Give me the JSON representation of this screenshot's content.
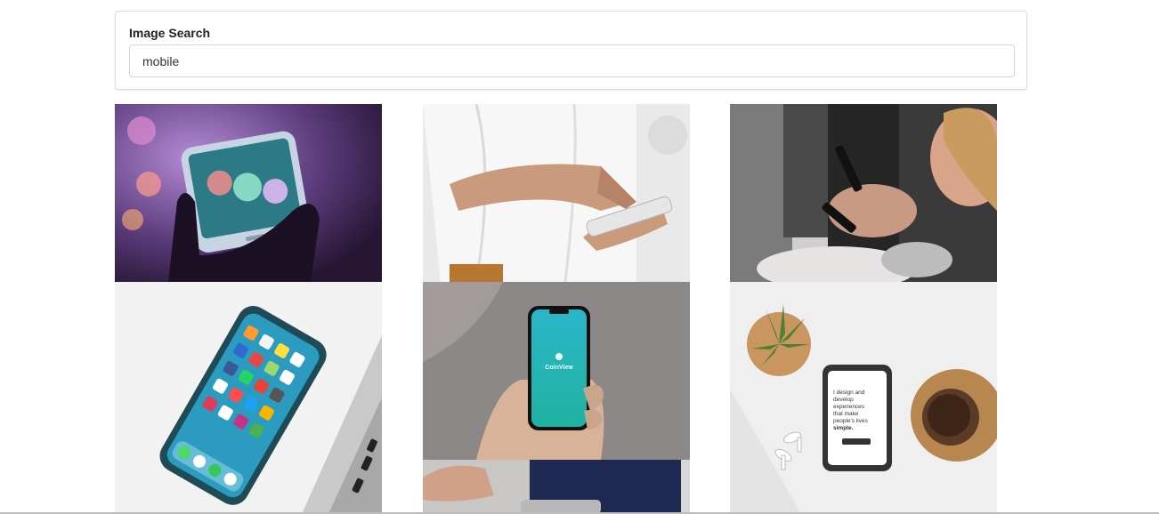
{
  "search": {
    "label": "Image Search",
    "value": "mobile"
  },
  "results": [
    {
      "icon": "phone-bokeh-image"
    },
    {
      "icon": "man-using-phone-image"
    },
    {
      "icon": "people-phones-image"
    },
    {
      "icon": "iphone-app-grid-image"
    },
    {
      "icon": "hand-holding-phone-image",
      "screen_text": "CoinView"
    },
    {
      "icon": "phone-on-desk-image",
      "screen_text": [
        "I design and",
        "develop",
        "experiences",
        "that make",
        "people's lives",
        "simple."
      ]
    },
    {
      "icon": "phone-partial-image"
    }
  ]
}
